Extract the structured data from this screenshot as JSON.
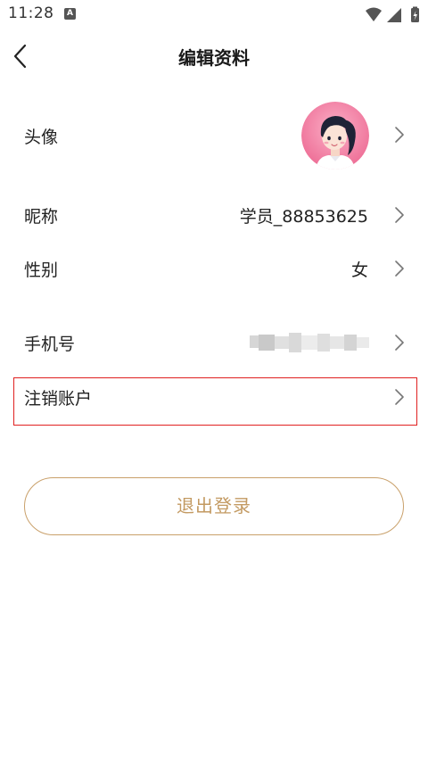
{
  "status_bar": {
    "time": "11:28",
    "notification_icon": "A",
    "icons": [
      "wifi-icon",
      "signal-icon",
      "battery-charging-icon"
    ]
  },
  "header": {
    "title": "编辑资料",
    "back_icon": "chevron-left-icon"
  },
  "rows": {
    "avatar": {
      "label": "头像"
    },
    "nickname": {
      "label": "昵称",
      "value": "学员_88853625"
    },
    "gender": {
      "label": "性别",
      "value": "女"
    },
    "phone": {
      "label": "手机号"
    },
    "cancel_account": {
      "label": "注销账户"
    }
  },
  "logout": {
    "label": "退出登录"
  },
  "colors": {
    "accent": "#c39a62",
    "highlight_border": "#e02020",
    "avatar_bg": "#f07aa0"
  }
}
